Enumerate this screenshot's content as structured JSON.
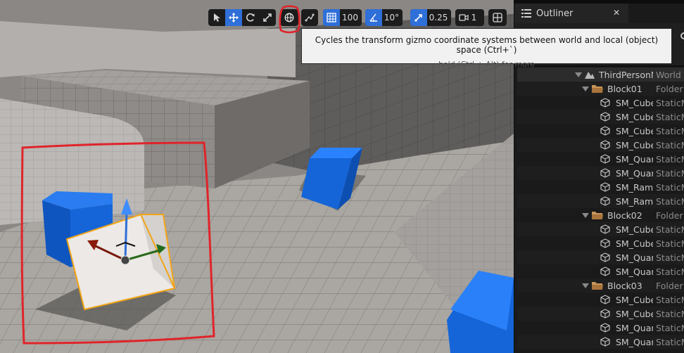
{
  "toolbar": {
    "grid_snap_value": "100",
    "rotation_snap_value": "10°",
    "scale_snap_value": "0.25",
    "camera_speed_value": "1"
  },
  "tooltip": {
    "main": "Cycles the transform gizmo coordinate systems between world and local (object) space (Ctrl+`)",
    "sub": "hold (Ctrl + Alt) for more"
  },
  "outliner": {
    "tab_title": "Outliner",
    "close_glyph": "✕",
    "rows": [
      {
        "label": "ThirdPersonMap",
        "type": "World",
        "depth": 0,
        "kind": "world"
      },
      {
        "label": "Block01",
        "type": "Folder",
        "depth": 1,
        "kind": "folder"
      },
      {
        "label": "SM_Cube",
        "type": "StaticMeshActor",
        "depth": 2,
        "kind": "mesh"
      },
      {
        "label": "SM_Cube",
        "type": "StaticMeshActor",
        "depth": 2,
        "kind": "mesh"
      },
      {
        "label": "SM_Cube",
        "type": "StaticMeshActor",
        "depth": 2,
        "kind": "mesh"
      },
      {
        "label": "SM_Cube",
        "type": "StaticMeshActor",
        "depth": 2,
        "kind": "mesh"
      },
      {
        "label": "SM_QuarterCylinder",
        "type": "StaticMeshActor",
        "depth": 2,
        "kind": "mesh"
      },
      {
        "label": "SM_QuarterCylinder",
        "type": "StaticMeshActor",
        "depth": 2,
        "kind": "mesh"
      },
      {
        "label": "SM_Ramp",
        "type": "StaticMeshActor",
        "depth": 2,
        "kind": "mesh"
      },
      {
        "label": "SM_Ramp",
        "type": "StaticMeshActor",
        "depth": 2,
        "kind": "mesh"
      },
      {
        "label": "Block02",
        "type": "Folder",
        "depth": 1,
        "kind": "folder"
      },
      {
        "label": "SM_Cube",
        "type": "StaticMeshActor",
        "depth": 2,
        "kind": "mesh"
      },
      {
        "label": "SM_Cube",
        "type": "StaticMeshActor",
        "depth": 2,
        "kind": "mesh"
      },
      {
        "label": "SM_QuarterCylinder",
        "type": "StaticMeshActor",
        "depth": 2,
        "kind": "mesh"
      },
      {
        "label": "SM_QuarterCylinder",
        "type": "StaticMeshActor",
        "depth": 2,
        "kind": "mesh"
      },
      {
        "label": "Block03",
        "type": "Folder",
        "depth": 1,
        "kind": "folder"
      },
      {
        "label": "SM_Cube",
        "type": "StaticMeshActor",
        "depth": 2,
        "kind": "mesh"
      },
      {
        "label": "SM_Cube",
        "type": "StaticMeshActor",
        "depth": 2,
        "kind": "mesh"
      },
      {
        "label": "SM_QuarterCylinder",
        "type": "StaticMeshActor",
        "depth": 2,
        "kind": "mesh"
      },
      {
        "label": "SM_QuarterCylinder",
        "type": "StaticMeshActor",
        "depth": 2,
        "kind": "mesh"
      }
    ]
  },
  "colors": {
    "accent": "#2f6fd8",
    "annotation": "#e0242a",
    "cube_blue": "#1565d8",
    "folder": "#c8955a"
  }
}
